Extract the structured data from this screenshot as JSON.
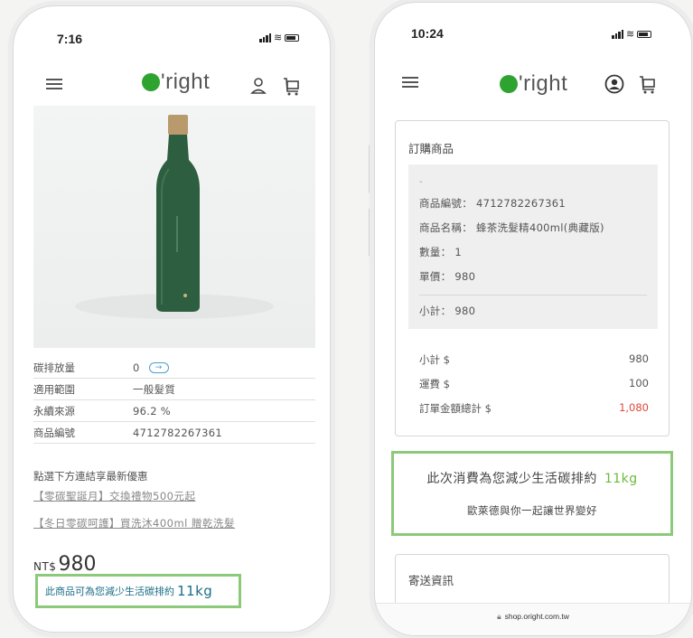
{
  "left_phone": {
    "status": {
      "time": "7:16"
    },
    "brand": {
      "logo_text": "'right",
      "logo_dot_color": "#2fa32f"
    },
    "product": {
      "image": "green-bottle-image",
      "specs": [
        {
          "label": "碳排放量",
          "value": "0"
        },
        {
          "label": "適用範圍",
          "value": "一般髮質"
        },
        {
          "label": "永續來源",
          "value": "96.2 %"
        },
        {
          "label": "商品編號",
          "value": "4712782267361"
        }
      ],
      "promo_title": "點選下方連結享最新優惠",
      "promo_links": [
        "【零碳聖誕月】交換禮物500元起",
        "【冬日零碳呵護】買洗沐400ml 贈乾洗髮"
      ],
      "price_currency": "NT$",
      "price_value": "980",
      "carbon_note": "此商品可為您減少生活碳排約",
      "carbon_amount": "11kg",
      "highlight_color": "#8cc97a"
    }
  },
  "right_phone": {
    "status": {
      "time": "10:24"
    },
    "brand": {
      "logo_text": "'right"
    },
    "order": {
      "title": "訂購商品",
      "dash": "-",
      "item_lines": [
        "商品編號： 4712782267361",
        "商品名稱： 蜂茶洗髮精400ml(典藏版)",
        "數量： 1",
        "單價： 980"
      ],
      "item_subtotal": "小計： 980",
      "summary": [
        {
          "label": "小計 $",
          "value": "980"
        },
        {
          "label": "運費 $",
          "value": "100"
        },
        {
          "label": "訂單金額總計 $",
          "value": "1,080"
        }
      ],
      "total_color": "#e0463a"
    },
    "carbon": {
      "line1": "此次消費為您減少生活碳排約",
      "amount": "11kg",
      "line2": "歐萊德與你一起讓世界變好"
    },
    "shipping_title": "寄送資訊",
    "url": "shop.oright.com.tw"
  }
}
